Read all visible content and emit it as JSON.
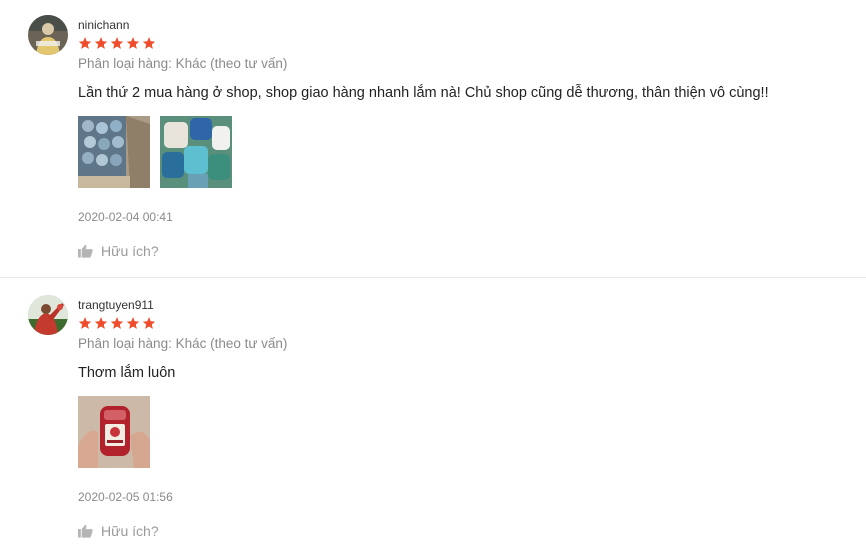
{
  "reviews": [
    {
      "username": "ninichann",
      "rating": 5,
      "variation": "Phân loại hàng: Khác (theo tư vấn)",
      "comment": "Lần thứ 2 mua hàng ở shop, shop giao hàng nhanh lắm nà! Chủ shop cũng dễ thương, thân thiện vô cùng!!",
      "photo_count": 2,
      "timestamp": "2020-02-04 00:41",
      "helpful_label": "Hữu ích?"
    },
    {
      "username": "trangtuyen911",
      "rating": 5,
      "variation": "Phân loại hàng: Khác (theo tư vấn)",
      "comment": "Thơm lắm luôn",
      "photo_count": 1,
      "timestamp": "2020-02-05 01:56",
      "helpful_label": "Hữu ích?"
    }
  ],
  "colors": {
    "star": "#ee4d2d",
    "muted_text": "#8a8a8a",
    "divider": "#e8e8e8"
  },
  "icons": {
    "star": "star-icon",
    "helpful": "thumbs-up-icon"
  }
}
